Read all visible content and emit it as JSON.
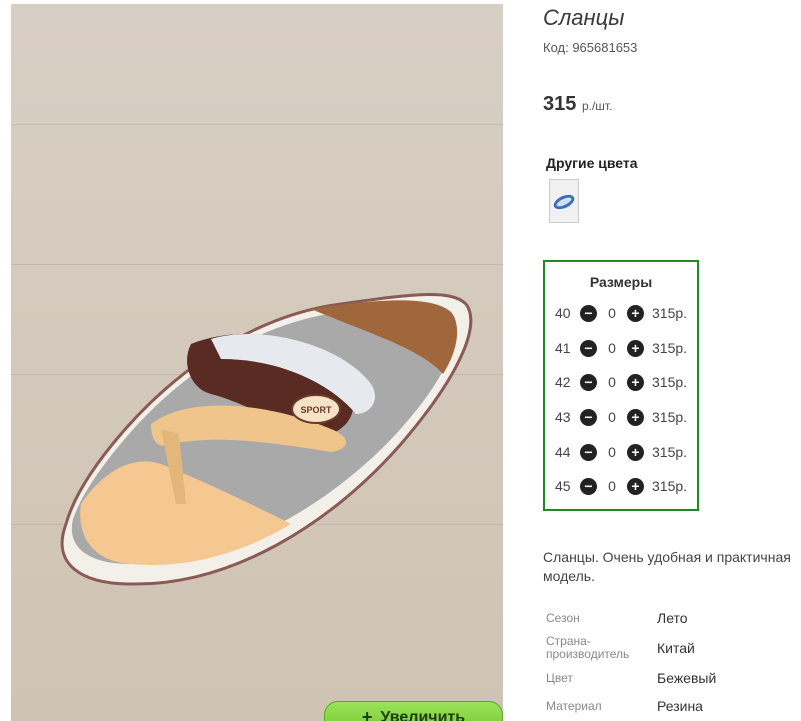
{
  "product": {
    "title": "Сланцы",
    "code": "Код: 965681653",
    "price": "315",
    "price_unit": "р./шт.",
    "colors_title": "Другие цвета",
    "zoom_label": "Увеличить"
  },
  "sizes": {
    "title": "Размеры",
    "rows": [
      {
        "size": "40",
        "qty": "0",
        "price": "315р."
      },
      {
        "size": "41",
        "qty": "0",
        "price": "315р."
      },
      {
        "size": "42",
        "qty": "0",
        "price": "315р."
      },
      {
        "size": "43",
        "qty": "0",
        "price": "315р."
      },
      {
        "size": "44",
        "qty": "0",
        "price": "315р."
      },
      {
        "size": "45",
        "qty": "0",
        "price": "315р."
      }
    ]
  },
  "description": "Сланцы. Очень удобная и практичная модель.",
  "attributes": [
    {
      "label": "Сезон",
      "value": "Лето"
    },
    {
      "label": "Страна-производитель",
      "value": "Китай"
    },
    {
      "label": "Цвет",
      "value": "Бежевый"
    },
    {
      "label": "Материал",
      "value": "Резина"
    }
  ],
  "icons": {
    "minus": "minus-circle-icon",
    "plus": "plus-circle-icon"
  },
  "colors": {
    "accent_border": "#1f8a1f",
    "zoom_button": "#7ed13d"
  }
}
